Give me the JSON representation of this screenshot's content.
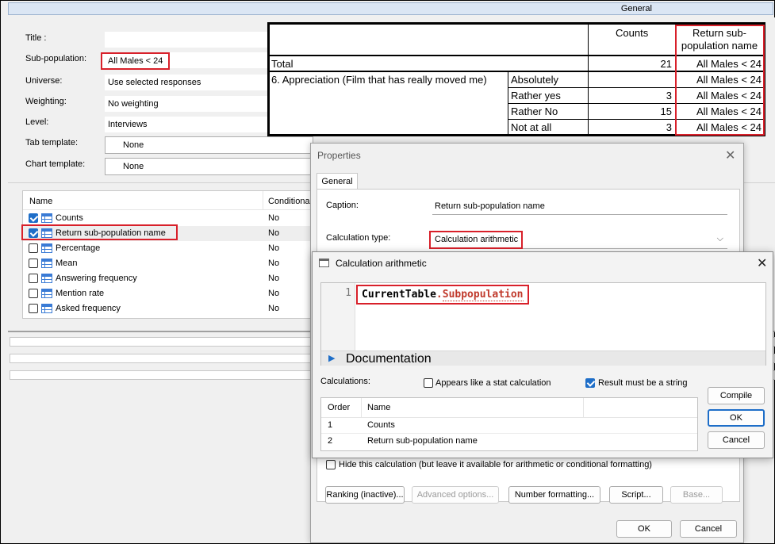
{
  "general_tab_label": "General",
  "form": {
    "title_label": "Title :",
    "title_value": "",
    "subpop_label": "Sub-population:",
    "subpop_value": "All Males < 24",
    "universe_label": "Universe:",
    "universe_value": "Use selected responses",
    "weighting_label": "Weighting:",
    "weighting_value": "No weighting",
    "level_label": "Level:",
    "level_value": "Interviews",
    "tab_template_label": "Tab template:",
    "tab_template_value": "None",
    "chart_template_label": "Chart template:",
    "chart_template_value": "None"
  },
  "calc_list": {
    "col_name": "Name",
    "col_conditional": "Conditional",
    "rows": [
      {
        "name": "Counts",
        "checked": true,
        "conditional": "No"
      },
      {
        "name": "Return sub-population name",
        "checked": true,
        "conditional": "No"
      },
      {
        "name": "Percentage",
        "checked": false,
        "conditional": "No"
      },
      {
        "name": "Mean",
        "checked": false,
        "conditional": "No"
      },
      {
        "name": "Answering frequency",
        "checked": false,
        "conditional": "No"
      },
      {
        "name": "Mention rate",
        "checked": false,
        "conditional": "No"
      },
      {
        "name": "Asked frequency",
        "checked": false,
        "conditional": "No"
      }
    ]
  },
  "result_table": {
    "col_counts": "Counts",
    "col_return": "Return sub-population name",
    "total_label": "Total",
    "total_count": "21",
    "total_return": "All Males < 24",
    "question_label": "6. Appreciation (Film that has really moved me)",
    "rows": [
      {
        "label": "Absolutely",
        "count": "",
        "return": "All Males < 24"
      },
      {
        "label": "Rather yes",
        "count": "3",
        "return": "All Males < 24"
      },
      {
        "label": "Rather No",
        "count": "15",
        "return": "All Males < 24"
      },
      {
        "label": "Not at all",
        "count": "3",
        "return": "All Males < 24"
      }
    ]
  },
  "properties": {
    "title": "Properties",
    "close_icon": "✕",
    "tab_general": "General",
    "caption_label": "Caption:",
    "caption_value": "Return sub-population name",
    "calc_type_label": "Calculation type:",
    "calc_type_value": "Calculation arithmetic",
    "hide_calc_label": "Hide this calculation (but leave it available for arithmetic or conditional formatting)",
    "btn_ranking": "Ranking (inactive)...",
    "btn_advanced": "Advanced options...",
    "btn_number_format": "Number formatting...",
    "btn_script": "Script...",
    "btn_base": "Base...",
    "btn_ok": "OK",
    "btn_cancel": "Cancel"
  },
  "calc_dialog": {
    "title": "Calculation arithmetic",
    "close_icon": "✕",
    "line_number": "1",
    "code_object": "CurrentTable",
    "code_dot": ".",
    "code_property": "Subpopulation",
    "documentation_label": "Documentation",
    "calculations_label": "Calculations:",
    "stat_calc_label": "Appears like a stat calculation",
    "stat_calc_checked": false,
    "string_result_label": "Result must be a string",
    "string_result_checked": true,
    "list_col_order": "Order",
    "list_col_name": "Name",
    "list_rows": [
      {
        "order": "1",
        "name": "Counts"
      },
      {
        "order": "2",
        "name": "Return sub-population name"
      }
    ],
    "btn_compile": "Compile",
    "btn_ok": "OK",
    "btn_cancel": "Cancel"
  },
  "colors": {
    "highlight_red": "#d8202a",
    "accent_blue": "#1e6ec8"
  }
}
